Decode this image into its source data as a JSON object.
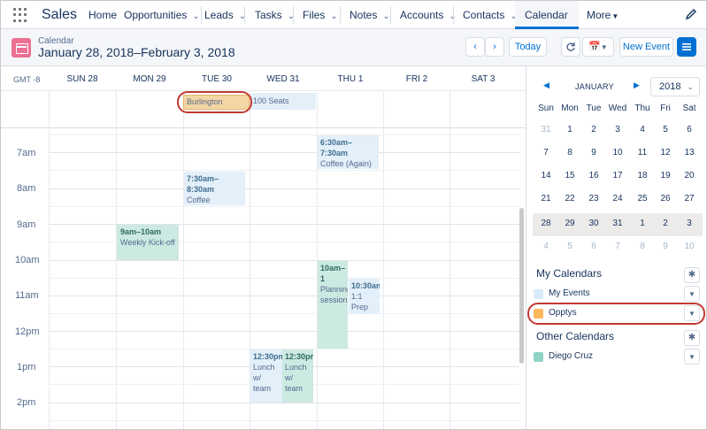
{
  "nav": {
    "app_name": "Sales",
    "items": [
      {
        "label": "Home",
        "has_menu": false
      },
      {
        "label": "Opportunities",
        "has_menu": true
      },
      {
        "label": "Leads",
        "has_menu": true
      },
      {
        "label": "Tasks",
        "has_menu": true
      },
      {
        "label": "Files",
        "has_menu": true
      },
      {
        "label": "Notes",
        "has_menu": true
      },
      {
        "label": "Accounts",
        "has_menu": true
      },
      {
        "label": "Contacts",
        "has_menu": true
      },
      {
        "label": "Calendar",
        "has_menu": true,
        "active": true
      },
      {
        "label": "More",
        "has_menu": true
      }
    ]
  },
  "header": {
    "object_label": "Calendar",
    "date_range": "January 28, 2018–February 3, 2018",
    "today_label": "Today",
    "new_event_label": "New Event"
  },
  "week": {
    "timezone": "GMT -8",
    "days": [
      "SUN 28",
      "MON 29",
      "TUE 30",
      "WED 31",
      "THU 1",
      "FRI 2",
      "SAT 3"
    ],
    "hours": [
      "7am",
      "8am",
      "9am",
      "10am",
      "11am",
      "12pm",
      "1pm",
      "2pm"
    ],
    "allday_events": [
      {
        "title": "Burlington Textil...",
        "color": "orange"
      },
      {
        "title": "100 Seats",
        "color": "blue"
      }
    ],
    "events": [
      {
        "time": "6:30am–7:30am",
        "title": "Coffee (Again)",
        "color": "blue"
      },
      {
        "time": "7:30am–8:30am",
        "title": "Coffee",
        "color": "blue"
      },
      {
        "time": "9am–10am",
        "title": "Weekly Kick-off",
        "color": "green"
      },
      {
        "time": "10am–1",
        "title": "Planning sessions",
        "color": "green"
      },
      {
        "time": "10:30am",
        "title": "1:1 Prep",
        "color": "blue"
      },
      {
        "time": "12:30pm",
        "title": "Lunch w/ team",
        "color": "blue"
      },
      {
        "time": "12:30pm",
        "title": "Lunch w/ team",
        "color": "green"
      }
    ]
  },
  "mini_calendar": {
    "month": "JANUARY",
    "year": "2018",
    "weekdays": [
      "Sun",
      "Mon",
      "Tue",
      "Wed",
      "Thu",
      "Fri",
      "Sat"
    ],
    "weeks": [
      [
        "31",
        "1",
        "2",
        "3",
        "4",
        "5",
        "6"
      ],
      [
        "7",
        "8",
        "9",
        "10",
        "11",
        "12",
        "13"
      ],
      [
        "14",
        "15",
        "16",
        "17",
        "18",
        "19",
        "20"
      ],
      [
        "21",
        "22",
        "23",
        "24",
        "25",
        "26",
        "27"
      ],
      [
        "28",
        "29",
        "30",
        "31",
        "1",
        "2",
        "3"
      ],
      [
        "4",
        "5",
        "6",
        "7",
        "8",
        "9",
        "10"
      ]
    ]
  },
  "my_calendars": {
    "title": "My Calendars",
    "items": [
      {
        "name": "My Events",
        "color": "#d8ebfa"
      },
      {
        "name": "Opptys",
        "color": "#ffb75d"
      }
    ]
  },
  "other_calendars": {
    "title": "Other Calendars",
    "items": [
      {
        "name": "Diego Cruz",
        "color": "#8fd4c6"
      }
    ]
  },
  "colors": {
    "brand": "#0070d2",
    "calendar_icon": "#eb7092",
    "highlight": "#c23934"
  }
}
